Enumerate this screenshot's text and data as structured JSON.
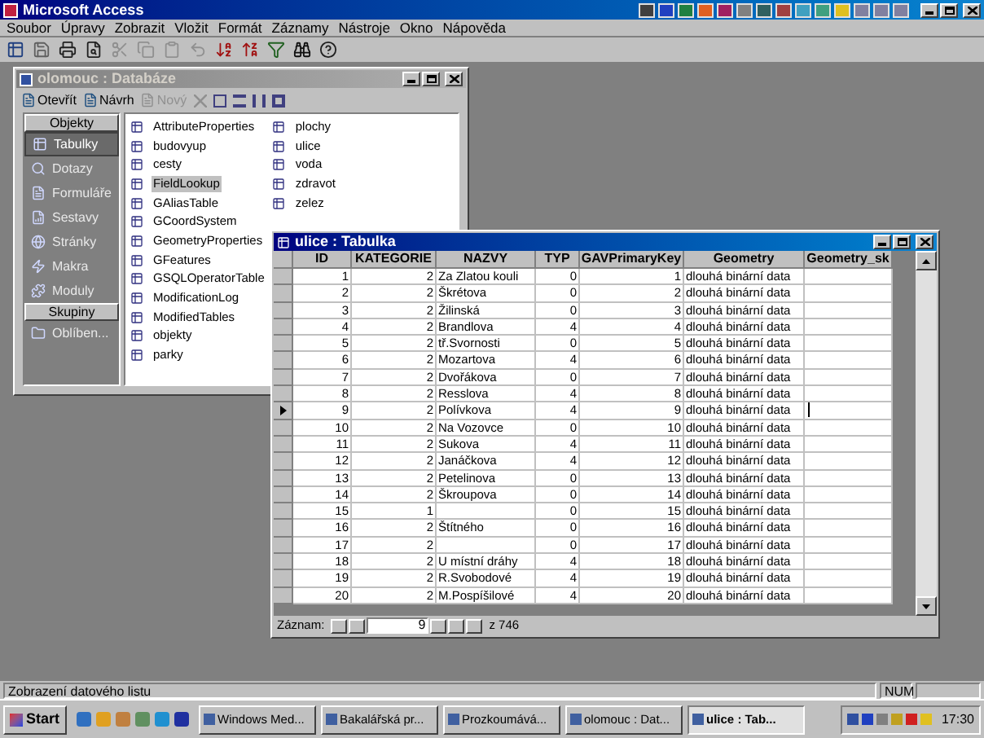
{
  "window": {
    "title": "Microsoft Access"
  },
  "menu": [
    {
      "label": "Soubor"
    },
    {
      "label": "Úpravy"
    },
    {
      "label": "Zobrazit"
    },
    {
      "label": "Vložit"
    },
    {
      "label": "Formát"
    },
    {
      "label": "Záznamy"
    },
    {
      "label": "Nástroje"
    },
    {
      "label": "Okno"
    },
    {
      "label": "Nápověda"
    }
  ],
  "database_window": {
    "title": "olomouc : Databáze",
    "toolbar": [
      {
        "label": "Otevřít",
        "disabled": false
      },
      {
        "label": "Návrh",
        "disabled": false
      },
      {
        "label": "Nový",
        "disabled": true
      }
    ],
    "groups": [
      {
        "header": "Objekty",
        "items": [
          {
            "label": "Tabulky",
            "selected": true
          },
          {
            "label": "Dotazy",
            "selected": false
          },
          {
            "label": "Formuláře",
            "selected": false
          },
          {
            "label": "Sestavy",
            "selected": false
          },
          {
            "label": "Stránky",
            "selected": false
          },
          {
            "label": "Makra",
            "selected": false
          },
          {
            "label": "Moduly",
            "selected": false
          }
        ]
      },
      {
        "header": "Skupiny",
        "items": [
          {
            "label": "Oblíben...",
            "selected": false
          }
        ]
      }
    ],
    "tables": [
      {
        "label": "AttributeProperties",
        "selected": false
      },
      {
        "label": "budovyup",
        "selected": false
      },
      {
        "label": "cesty",
        "selected": false
      },
      {
        "label": "FieldLookup",
        "selected": true
      },
      {
        "label": "GAliasTable",
        "selected": false
      },
      {
        "label": "GCoordSystem",
        "selected": false
      },
      {
        "label": "GeometryProperties",
        "selected": false
      },
      {
        "label": "GFeatures",
        "selected": false
      },
      {
        "label": "GSQLOperatorTable",
        "selected": false
      },
      {
        "label": "ModificationLog",
        "selected": false
      },
      {
        "label": "ModifiedTables",
        "selected": false
      },
      {
        "label": "objekty",
        "selected": false
      },
      {
        "label": "parky",
        "selected": false
      },
      {
        "label": "plochy",
        "selected": false
      },
      {
        "label": "ulice",
        "selected": false
      },
      {
        "label": "voda",
        "selected": false
      },
      {
        "label": "zdravot",
        "selected": false
      },
      {
        "label": "zelez",
        "selected": false
      }
    ]
  },
  "table_window": {
    "title": "ulice : Tabulka",
    "columns": [
      {
        "label": "ID",
        "kind": "number"
      },
      {
        "label": "KATEGORIE",
        "kind": "number"
      },
      {
        "label": "NAZVY",
        "kind": "text"
      },
      {
        "label": "TYP",
        "kind": "number"
      },
      {
        "label": "GAVPrimaryKey",
        "kind": "number"
      },
      {
        "label": "Geometry",
        "kind": "text"
      },
      {
        "label": "Geometry_sk",
        "kind": "text"
      }
    ],
    "rows": [
      {
        "current": false,
        "cells": [
          "1",
          "2",
          "Za Zlatou kouli",
          "0",
          "1",
          "dlouhá binární data"
        ]
      },
      {
        "current": false,
        "cells": [
          "2",
          "2",
          "Škrétova",
          "0",
          "2",
          "dlouhá binární data"
        ]
      },
      {
        "current": false,
        "cells": [
          "3",
          "2",
          "Žilinská",
          "0",
          "3",
          "dlouhá binární data"
        ]
      },
      {
        "current": false,
        "cells": [
          "4",
          "2",
          "Brandlova",
          "4",
          "4",
          "dlouhá binární data"
        ]
      },
      {
        "current": false,
        "cells": [
          "5",
          "2",
          "tř.Svornosti",
          "0",
          "5",
          "dlouhá binární data"
        ]
      },
      {
        "current": false,
        "cells": [
          "6",
          "2",
          "Mozartova",
          "4",
          "6",
          "dlouhá binární data"
        ]
      },
      {
        "current": false,
        "cells": [
          "7",
          "2",
          "Dvořákova",
          "0",
          "7",
          "dlouhá binární data"
        ]
      },
      {
        "current": false,
        "cells": [
          "8",
          "2",
          "Resslova",
          "4",
          "8",
          "dlouhá binární data"
        ]
      },
      {
        "current": true,
        "cells": [
          "9",
          "2",
          "Polívkova",
          "4",
          "9",
          "dlouhá binární data"
        ]
      },
      {
        "current": false,
        "cells": [
          "10",
          "2",
          "Na Vozovce",
          "0",
          "10",
          "dlouhá binární data"
        ]
      },
      {
        "current": false,
        "cells": [
          "11",
          "2",
          "Sukova",
          "4",
          "11",
          "dlouhá binární data"
        ]
      },
      {
        "current": false,
        "cells": [
          "12",
          "2",
          "Janáčkova",
          "4",
          "12",
          "dlouhá binární data"
        ]
      },
      {
        "current": false,
        "cells": [
          "13",
          "2",
          "Petelinova",
          "0",
          "13",
          "dlouhá binární data"
        ]
      },
      {
        "current": false,
        "cells": [
          "14",
          "2",
          "Škroupova",
          "0",
          "14",
          "dlouhá binární data"
        ]
      },
      {
        "current": false,
        "cells": [
          "15",
          "1",
          null,
          "0",
          "15",
          "dlouhá binární data"
        ]
      },
      {
        "current": false,
        "cells": [
          "16",
          "2",
          "Štítného",
          "0",
          "16",
          "dlouhá binární data"
        ]
      },
      {
        "current": false,
        "cells": [
          "17",
          "2",
          null,
          "0",
          "17",
          "dlouhá binární data"
        ]
      },
      {
        "current": false,
        "cells": [
          "18",
          "2",
          "U místní dráhy",
          "4",
          "18",
          "dlouhá binární data"
        ]
      },
      {
        "current": false,
        "cells": [
          "19",
          "2",
          "R.Svobodové",
          "4",
          "19",
          "dlouhá binární data"
        ]
      },
      {
        "current": false,
        "cells": [
          "20",
          "2",
          "M.Pospíšilové",
          "4",
          "20",
          "dlouhá binární data"
        ]
      }
    ],
    "navigator": {
      "label": "Záznam:",
      "value": "9",
      "total": "z 746"
    }
  },
  "status_bar": {
    "text": "Zobrazení datového listu",
    "indicator": "NUM"
  },
  "taskbar": {
    "start": "Start",
    "tasks": [
      {
        "label": "Windows Med...",
        "selected": false
      },
      {
        "label": "Bakalářská pr...",
        "selected": false
      },
      {
        "label": "Prozkoumává...",
        "selected": false
      },
      {
        "label": "olomouc : Dat...",
        "selected": false
      },
      {
        "label": "ulice : Tab...",
        "selected": true
      }
    ],
    "clock": "17:30"
  }
}
